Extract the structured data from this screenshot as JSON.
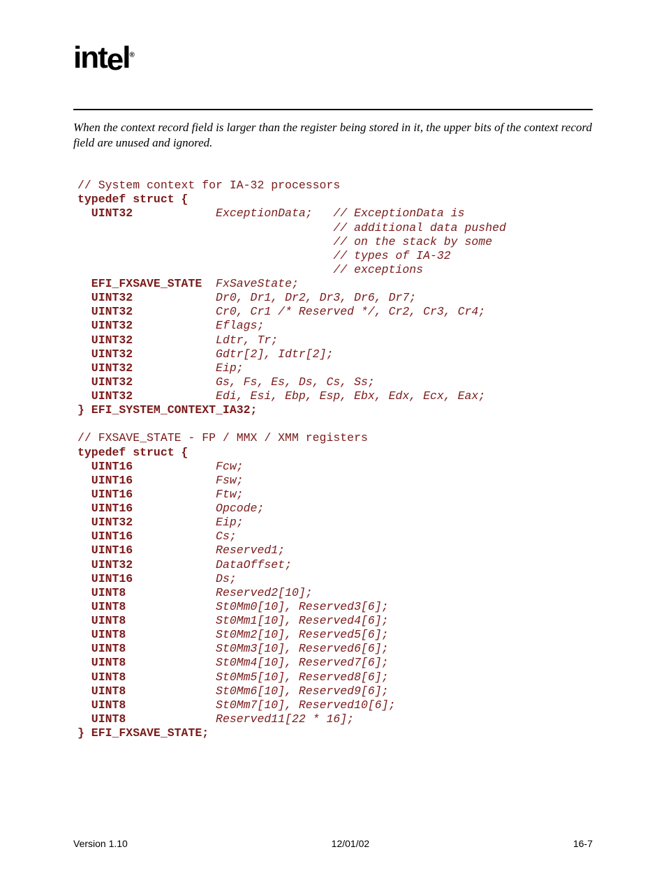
{
  "logo": "intel",
  "intro": "When the context record field is larger than the register being stored in it, the upper bits of the context record field are unused and ignored.",
  "code": {
    "lines": [
      {
        "parts": [
          {
            "cls": "n",
            "t": "// System context for IA-32 processors"
          }
        ]
      },
      {
        "parts": [
          {
            "cls": "b",
            "t": "typedef struct {"
          }
        ]
      },
      {
        "parts": [
          {
            "cls": "b",
            "t": "  UINT32            "
          },
          {
            "cls": "i",
            "t": "ExceptionData;   // ExceptionData is"
          }
        ]
      },
      {
        "parts": [
          {
            "cls": "i",
            "t": "                                     // additional data pushed"
          }
        ]
      },
      {
        "parts": [
          {
            "cls": "i",
            "t": "                                     // on the stack by some"
          }
        ]
      },
      {
        "parts": [
          {
            "cls": "i",
            "t": "                                     // types of IA-32"
          }
        ]
      },
      {
        "parts": [
          {
            "cls": "i",
            "t": "                                     // exceptions"
          }
        ]
      },
      {
        "parts": [
          {
            "cls": "b",
            "t": "  EFI_FXSAVE_STATE  "
          },
          {
            "cls": "i",
            "t": "FxSaveState;"
          }
        ]
      },
      {
        "parts": [
          {
            "cls": "b",
            "t": "  UINT32            "
          },
          {
            "cls": "i",
            "t": "Dr0, Dr1, Dr2, Dr3, Dr6, Dr7;"
          }
        ]
      },
      {
        "parts": [
          {
            "cls": "b",
            "t": "  UINT32            "
          },
          {
            "cls": "i",
            "t": "Cr0, Cr1 /* Reserved */, Cr2, Cr3, Cr4;"
          }
        ]
      },
      {
        "parts": [
          {
            "cls": "b",
            "t": "  UINT32            "
          },
          {
            "cls": "i",
            "t": "Eflags;"
          }
        ]
      },
      {
        "parts": [
          {
            "cls": "b",
            "t": "  UINT32            "
          },
          {
            "cls": "i",
            "t": "Ldtr, Tr;"
          }
        ]
      },
      {
        "parts": [
          {
            "cls": "b",
            "t": "  UINT32            "
          },
          {
            "cls": "i",
            "t": "Gdtr[2], Idtr[2];"
          }
        ]
      },
      {
        "parts": [
          {
            "cls": "b",
            "t": "  UINT32            "
          },
          {
            "cls": "i",
            "t": "Eip;"
          }
        ]
      },
      {
        "parts": [
          {
            "cls": "b",
            "t": "  UINT32            "
          },
          {
            "cls": "i",
            "t": "Gs, Fs, Es, Ds, Cs, Ss;"
          }
        ]
      },
      {
        "parts": [
          {
            "cls": "b",
            "t": "  UINT32            "
          },
          {
            "cls": "i",
            "t": "Edi, Esi, Ebp, Esp, Ebx, Edx, Ecx, Eax;"
          }
        ]
      },
      {
        "parts": [
          {
            "cls": "b",
            "t": "} EFI_SYSTEM_CONTEXT_IA32;"
          }
        ]
      },
      {
        "parts": [
          {
            "cls": "n",
            "t": ""
          }
        ]
      },
      {
        "parts": [
          {
            "cls": "n",
            "t": "// FXSAVE_STATE - FP / MMX / XMM registers"
          }
        ]
      },
      {
        "parts": [
          {
            "cls": "b",
            "t": "typedef struct {"
          }
        ]
      },
      {
        "parts": [
          {
            "cls": "b",
            "t": "  UINT16            "
          },
          {
            "cls": "i",
            "t": "Fcw;"
          }
        ]
      },
      {
        "parts": [
          {
            "cls": "b",
            "t": "  UINT16            "
          },
          {
            "cls": "i",
            "t": "Fsw;"
          }
        ]
      },
      {
        "parts": [
          {
            "cls": "b",
            "t": "  UINT16            "
          },
          {
            "cls": "i",
            "t": "Ftw;"
          }
        ]
      },
      {
        "parts": [
          {
            "cls": "b",
            "t": "  UINT16            "
          },
          {
            "cls": "i",
            "t": "Opcode;"
          }
        ]
      },
      {
        "parts": [
          {
            "cls": "b",
            "t": "  UINT32            "
          },
          {
            "cls": "i",
            "t": "Eip;"
          }
        ]
      },
      {
        "parts": [
          {
            "cls": "b",
            "t": "  UINT16            "
          },
          {
            "cls": "i",
            "t": "Cs;"
          }
        ]
      },
      {
        "parts": [
          {
            "cls": "b",
            "t": "  UINT16            "
          },
          {
            "cls": "i",
            "t": "Reserved1;"
          }
        ]
      },
      {
        "parts": [
          {
            "cls": "b",
            "t": "  UINT32            "
          },
          {
            "cls": "i",
            "t": "DataOffset;"
          }
        ]
      },
      {
        "parts": [
          {
            "cls": "b",
            "t": "  UINT16            "
          },
          {
            "cls": "i",
            "t": "Ds;"
          }
        ]
      },
      {
        "parts": [
          {
            "cls": "b",
            "t": "  UINT8             "
          },
          {
            "cls": "i",
            "t": "Reserved2[10];"
          }
        ]
      },
      {
        "parts": [
          {
            "cls": "b",
            "t": "  UINT8             "
          },
          {
            "cls": "i",
            "t": "St0Mm0[10], Reserved3[6];"
          }
        ]
      },
      {
        "parts": [
          {
            "cls": "b",
            "t": "  UINT8             "
          },
          {
            "cls": "i",
            "t": "St0Mm1[10], Reserved4[6];"
          }
        ]
      },
      {
        "parts": [
          {
            "cls": "b",
            "t": "  UINT8             "
          },
          {
            "cls": "i",
            "t": "St0Mm2[10], Reserved5[6];"
          }
        ]
      },
      {
        "parts": [
          {
            "cls": "b",
            "t": "  UINT8             "
          },
          {
            "cls": "i",
            "t": "St0Mm3[10], Reserved6[6];"
          }
        ]
      },
      {
        "parts": [
          {
            "cls": "b",
            "t": "  UINT8             "
          },
          {
            "cls": "i",
            "t": "St0Mm4[10], Reserved7[6];"
          }
        ]
      },
      {
        "parts": [
          {
            "cls": "b",
            "t": "  UINT8             "
          },
          {
            "cls": "i",
            "t": "St0Mm5[10], Reserved8[6];"
          }
        ]
      },
      {
        "parts": [
          {
            "cls": "b",
            "t": "  UINT8             "
          },
          {
            "cls": "i",
            "t": "St0Mm6[10], Reserved9[6];"
          }
        ]
      },
      {
        "parts": [
          {
            "cls": "b",
            "t": "  UINT8             "
          },
          {
            "cls": "i",
            "t": "St0Mm7[10], Reserved10[6];"
          }
        ]
      },
      {
        "parts": [
          {
            "cls": "b",
            "t": "  UINT8             "
          },
          {
            "cls": "i",
            "t": "Reserved11[22 * 16];"
          }
        ]
      },
      {
        "parts": [
          {
            "cls": "b",
            "t": "} EFI_FXSAVE_STATE;"
          }
        ]
      }
    ]
  },
  "footer": {
    "left": "Version 1.10",
    "center": "12/01/02",
    "right": "16-7"
  }
}
